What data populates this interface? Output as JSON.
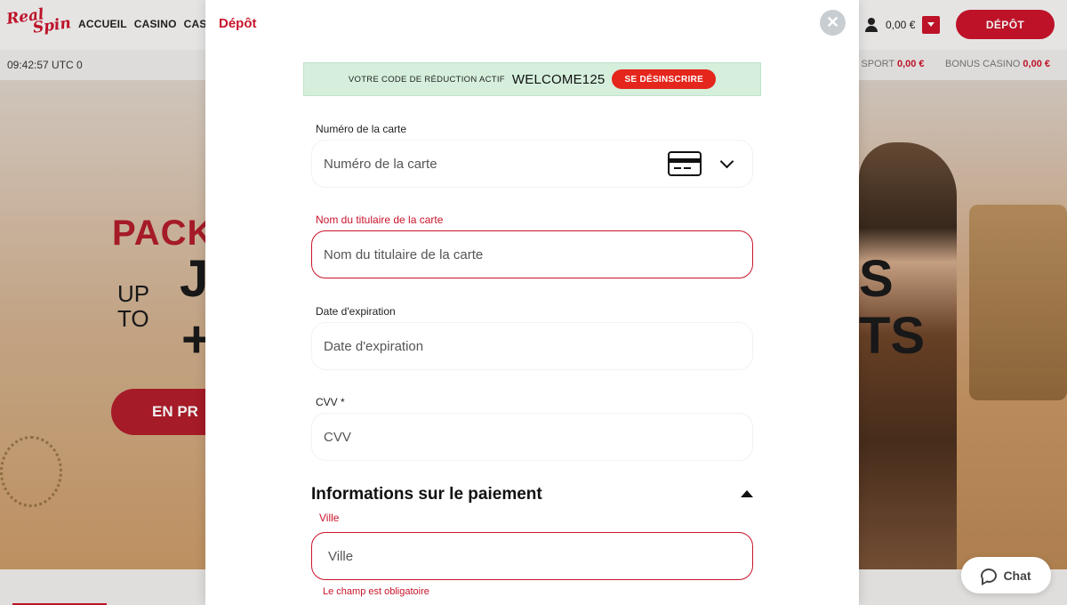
{
  "site": {
    "logo_line1": "Real",
    "logo_line2": "Spin",
    "nav": [
      "ACCUEIL",
      "CASINO",
      "CASI"
    ],
    "balance": "0,00 €",
    "depot_button": "DÉPÔT",
    "clock": "09:42:57 UTC 0",
    "bonus_sport_label": "S SPORT",
    "bonus_sport_value": "0,00 €",
    "bonus_casino_label": "BONUS CASINO",
    "bonus_casino_value": "0,00 €",
    "hero": {
      "pack": "PACK",
      "up": "UP",
      "to": "TO",
      "j": "J",
      "plus": "+",
      "s": "S",
      "ts": "TS",
      "cta": "EN PR"
    }
  },
  "modal": {
    "title": "Dépôt",
    "close": "✕",
    "promo": {
      "label": "VOTRE CODE DE RÉDUCTION ACTIF",
      "code": "WELCOME125",
      "unsubscribe": "SE DÉSINSCRIRE"
    },
    "fields": {
      "card_number": {
        "label": "Numéro de la carte",
        "placeholder": "Numéro de la carte"
      },
      "cardholder": {
        "label": "Nom du titulaire de la carte",
        "placeholder": "Nom du titulaire de la carte"
      },
      "expiry": {
        "label": "Date d'expiration",
        "placeholder": "Date d'expiration"
      },
      "cvv": {
        "label": "CVV *",
        "placeholder": "CVV"
      }
    },
    "payment_section": {
      "title": "Informations sur le paiement",
      "city": {
        "label": "Ville",
        "placeholder": "Ville",
        "error": "Le champ est obligatoire"
      }
    }
  },
  "chat": {
    "label": "Chat"
  },
  "colors": {
    "brand_red": "#c9142b",
    "promo_green": "#d5efdc",
    "unsubscribe_red": "#e5261c"
  }
}
